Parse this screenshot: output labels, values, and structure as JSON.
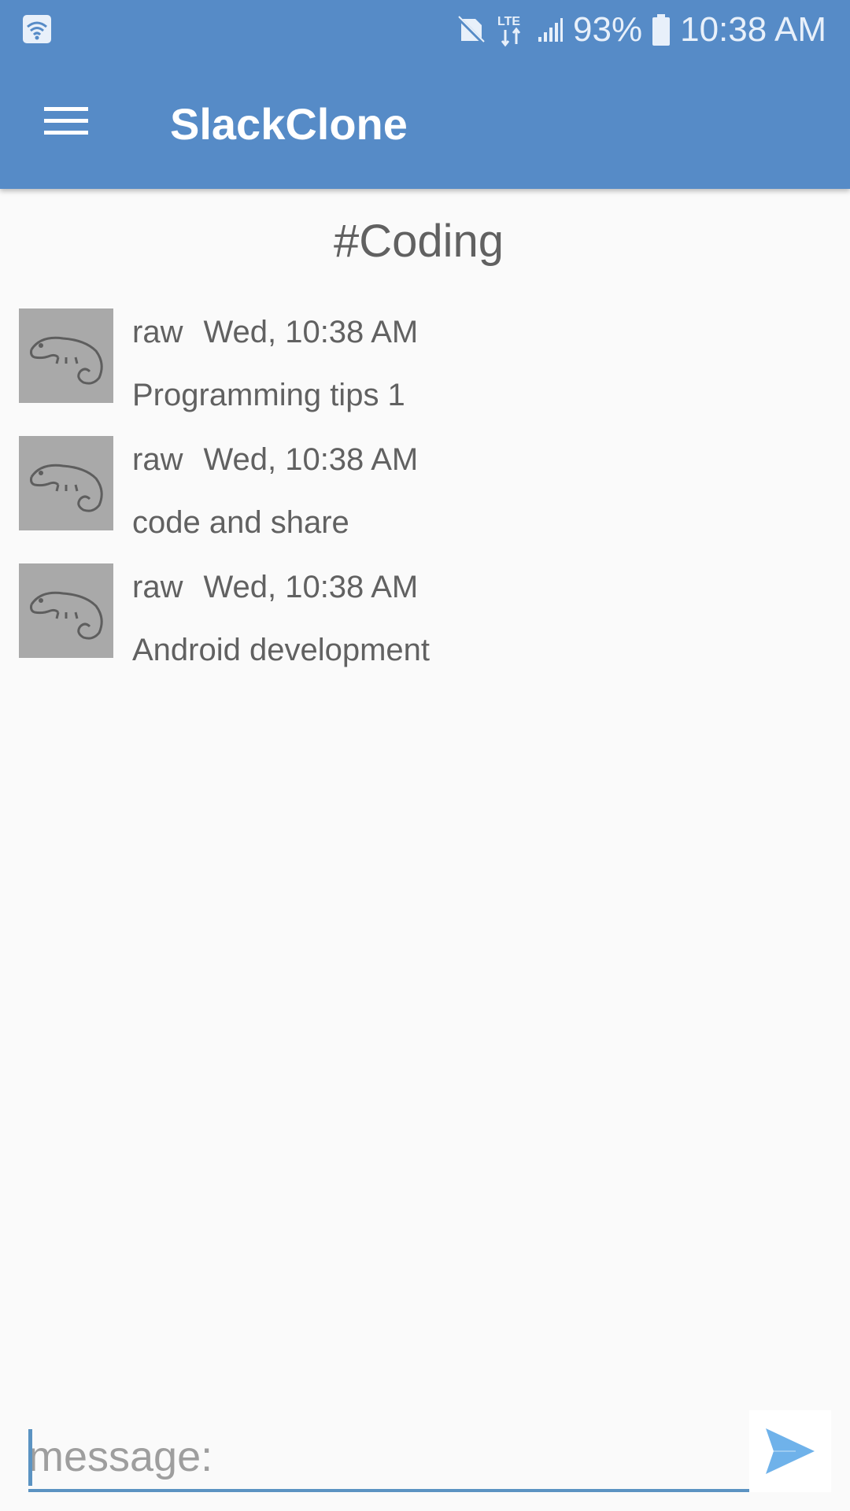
{
  "status_bar": {
    "battery": "93%",
    "time": "10:38 AM",
    "network": "LTE"
  },
  "toolbar": {
    "title": "SlackClone"
  },
  "channel": {
    "name": "#Coding"
  },
  "messages": [
    {
      "user": "raw",
      "time": "Wed, 10:38 AM",
      "text": "Programming tips 1"
    },
    {
      "user": "raw",
      "time": "Wed, 10:38 AM",
      "text": "code and share"
    },
    {
      "user": "raw",
      "time": "Wed, 10:38 AM",
      "text": "Android development"
    }
  ],
  "composer": {
    "placeholder": "message:"
  },
  "colors": {
    "app_bar": "#568bc7",
    "text": "#616161",
    "accent": "#5b93c2",
    "send_icon": "#6fb2ea",
    "avatar_bg": "#a9a9a9"
  },
  "icons": {
    "menu": "hamburger-menu-icon",
    "send": "send-icon",
    "avatar": "chameleon-avatar-icon"
  }
}
